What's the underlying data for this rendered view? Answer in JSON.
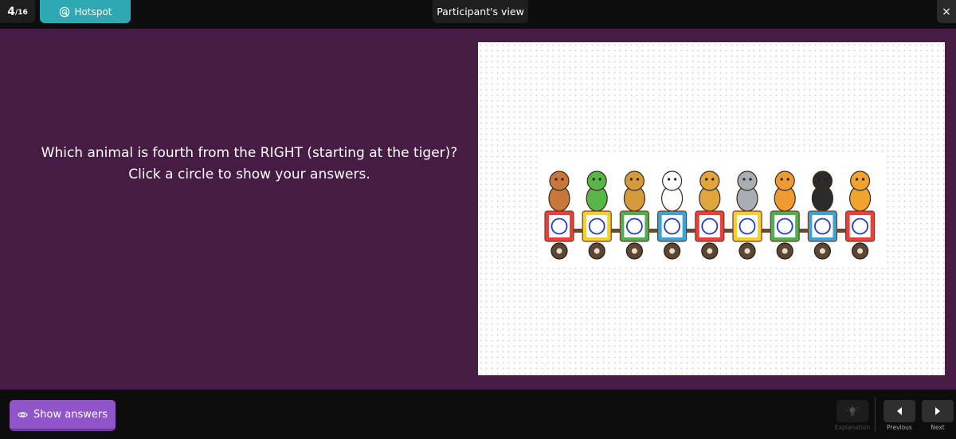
{
  "header": {
    "counter_current": "4",
    "counter_total": "/16",
    "question_type": "Hotspot",
    "view_label": "Participant's view",
    "close_symbol": "×"
  },
  "question": {
    "line1": "Which animal is fourth from the RIGHT (starting at the tiger)?",
    "line2": "Click a circle to show your answers."
  },
  "train": {
    "animals": [
      "bear",
      "crocodile",
      "lion",
      "panda",
      "deer",
      "elephant",
      "fox",
      "penguin",
      "tiger"
    ],
    "car_colors": [
      "#e8413b",
      "#f4d12a",
      "#4caf50",
      "#3aa3d9",
      "#e8413b",
      "#f4d12a",
      "#4caf50",
      "#3aa3d9",
      "#e8413b"
    ],
    "hotspot_color": "#1f3bd6"
  },
  "footer": {
    "show_answers_label": "Show answers",
    "explanation_label": "Explanation",
    "previous_label": "Previous",
    "next_label": "Next"
  },
  "colors": {
    "stage": "#461b44",
    "accent_teal": "#2ea8b3",
    "accent_purple": "#8f55c9"
  }
}
